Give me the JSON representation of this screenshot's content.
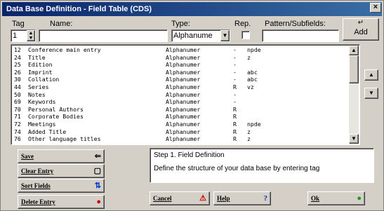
{
  "window": {
    "title": "Data Base Definition - Field Table (CDS)",
    "close_glyph": "×"
  },
  "header": {
    "tag_label": "Tag",
    "name_label": "Name:",
    "type_label": "Type:",
    "rep_label": "Rep.",
    "pattern_label": "Pattern/Subfields:",
    "tag_value": "1",
    "name_value": "",
    "type_value": "Alphanume",
    "pattern_value": ""
  },
  "add_button": {
    "label": "Add",
    "icon": "enter-arrow-icon",
    "glyph": "↵"
  },
  "fields_table": {
    "rows": [
      {
        "tag": "12",
        "name": "Conference main entry",
        "type": "Alphanumer",
        "rep": "-",
        "pattern": "npde"
      },
      {
        "tag": "24",
        "name": "Title",
        "type": "Alphanumer",
        "rep": "-",
        "pattern": "z"
      },
      {
        "tag": "25",
        "name": "Edition",
        "type": "Alphanumer",
        "rep": "-",
        "pattern": ""
      },
      {
        "tag": "26",
        "name": "Imprint",
        "type": "Alphanumer",
        "rep": "-",
        "pattern": "abc"
      },
      {
        "tag": "30",
        "name": "Collation",
        "type": "Alphanumer",
        "rep": "-",
        "pattern": "abc"
      },
      {
        "tag": "44",
        "name": "Series",
        "type": "Alphanumer",
        "rep": "R",
        "pattern": "vz"
      },
      {
        "tag": "50",
        "name": "Notes",
        "type": "Alphanumer",
        "rep": "-",
        "pattern": ""
      },
      {
        "tag": "69",
        "name": "Keywords",
        "type": "Alphanumer",
        "rep": "-",
        "pattern": ""
      },
      {
        "tag": "70",
        "name": "Personal Authors",
        "type": "Alphanumer",
        "rep": "R",
        "pattern": ""
      },
      {
        "tag": "71",
        "name": "Corporate Bodies",
        "type": "Alphanumer",
        "rep": "R",
        "pattern": ""
      },
      {
        "tag": "72",
        "name": "Meetings",
        "type": "Alphanumer",
        "rep": "R",
        "pattern": "npde"
      },
      {
        "tag": "74",
        "name": "Added Title",
        "type": "Alphanumer",
        "rep": "R",
        "pattern": "z"
      },
      {
        "tag": "76",
        "name": "Other language titles",
        "type": "Alphanumer",
        "rep": "R",
        "pattern": "z"
      }
    ]
  },
  "side_buttons": {
    "up_glyph": "▲",
    "down_glyph": "▼"
  },
  "left_buttons": {
    "save": {
      "label": "Save",
      "glyph": "⇐"
    },
    "clear": {
      "label": "Clear Entry",
      "glyph": "▢"
    },
    "sort": {
      "label": "Sort Fields",
      "glyph": "⇅"
    },
    "delete": {
      "label": "Delete Entry",
      "glyph": "●"
    }
  },
  "help": {
    "step": "Step 1. Field Definition",
    "text": "Define the structure of your data base by entering tag"
  },
  "bottom_buttons": {
    "cancel": {
      "label": "Cancel",
      "glyph": "⚠"
    },
    "help": {
      "label": "Help",
      "glyph": "?"
    },
    "ok": {
      "label": "Ok",
      "glyph": "●"
    }
  },
  "colors": {
    "titlebar_start": "#0a246a",
    "titlebar_end": "#3a6ea5",
    "face": "#d4d0c8",
    "cancel_icon": "#cc0000",
    "help_icon": "#0033cc",
    "ok_icon": "#1a9a1a",
    "delete_icon": "#cc0000"
  }
}
